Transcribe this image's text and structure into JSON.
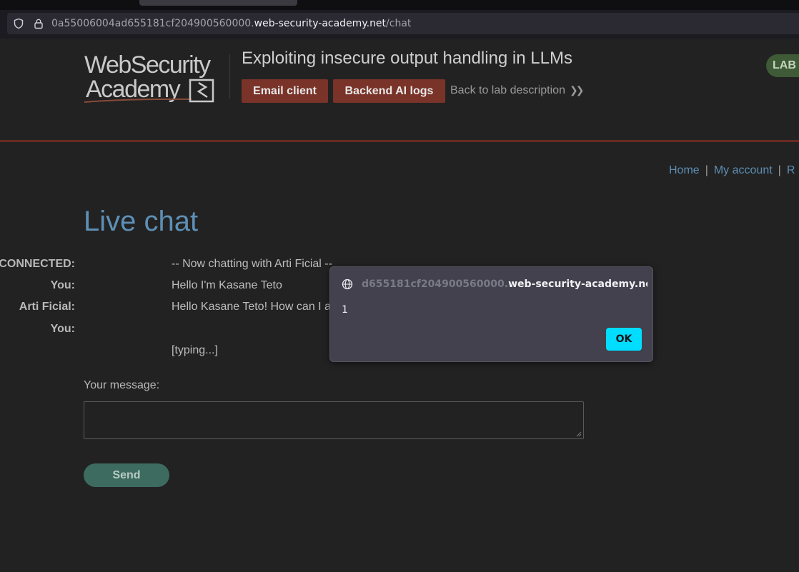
{
  "browser": {
    "url_prefix": "0a55006004ad655181cf204900560000.",
    "url_domain": "web-security-academy.net",
    "url_path": "/chat"
  },
  "header": {
    "logo_line1": "WebSecurity",
    "logo_line2": "Academy",
    "lab_title": "Exploiting insecure output handling in LLMs",
    "email_client_label": "Email client",
    "backend_logs_label": "Backend AI logs",
    "back_link_label": "Back to lab description",
    "lab_badge": "LAB"
  },
  "topnav": {
    "home": "Home",
    "sep1": "|",
    "my_account": "My account",
    "sep2": "|",
    "more": "R"
  },
  "chat": {
    "title": "Live chat",
    "rows": [
      {
        "who": "CONNECTED:",
        "msg": "-- Now chatting with Arti Ficial --"
      },
      {
        "who": "You:",
        "msg": "Hello I'm Kasane Teto"
      },
      {
        "who": "Arti Ficial:",
        "msg": "Hello Kasane Teto! How can I a"
      },
      {
        "who": "You:",
        "msg": ""
      },
      {
        "who": "",
        "msg": "[typing...]"
      }
    ],
    "message_label": "Your message:",
    "send_label": "Send"
  },
  "dialog": {
    "origin_faded": "d655181cf204900560000.",
    "origin_host": "web-security-academy.net",
    "message": "1",
    "ok_label": "OK"
  },
  "colors": {
    "accent_red": "#7a3328",
    "link_blue": "#5e8fb5",
    "send_green": "#3d6b5f",
    "ok_cyan": "#00ddff"
  }
}
